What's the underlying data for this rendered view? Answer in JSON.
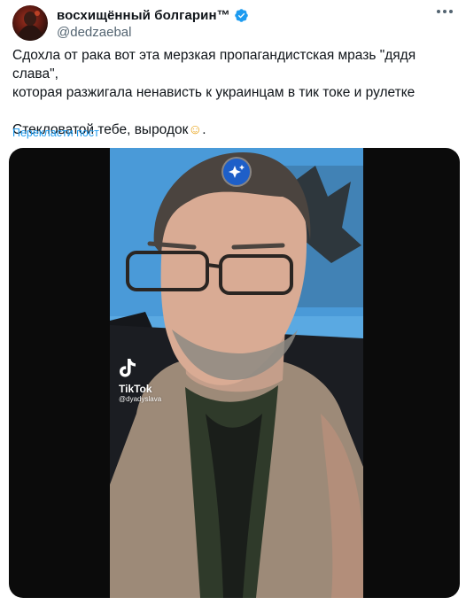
{
  "author": {
    "display_name": "восхищённый болгарин™",
    "handle": "@dedzaebal",
    "verified": true,
    "avatar_icon": "avatar-image"
  },
  "tweet": {
    "line1": "Сдохла от рака вот эта мерзкая пропагандистская мразь \"дядя слава\",",
    "line2": "которая разжигала ненависть к украинцам в тик токе и рулетке",
    "line3": "Стекловатой тебе, выродок",
    "emoji": "☺",
    "line3_end": ".",
    "translate_link": "Перекласти пост"
  },
  "media": {
    "watermark_brand": "TikTok",
    "watermark_user": "@dyadyslava",
    "overlay_icon": "sparkle-icon"
  },
  "colors": {
    "accent": "#1d9bf0",
    "secondary_text": "#536471"
  }
}
